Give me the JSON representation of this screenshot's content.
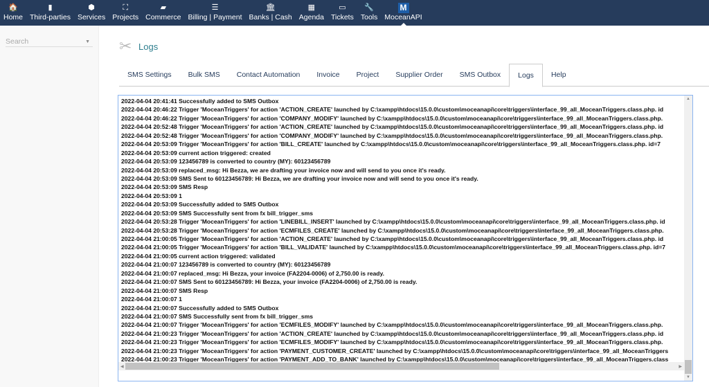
{
  "topnav": [
    {
      "label": "Home",
      "icon": "🏠"
    },
    {
      "label": "Third-parties",
      "icon": "▮"
    },
    {
      "label": "Services",
      "icon": "⬢"
    },
    {
      "label": "Projects",
      "icon": "⛶"
    },
    {
      "label": "Commerce",
      "icon": "▰"
    },
    {
      "label": "Billing | Payment",
      "icon": "☰"
    },
    {
      "label": "Banks | Cash",
      "icon": "🏛"
    },
    {
      "label": "Agenda",
      "icon": "▦"
    },
    {
      "label": "Tickets",
      "icon": "▭"
    },
    {
      "label": "Tools",
      "icon": "🔧"
    },
    {
      "label": "MoceanAPI",
      "icon": "M"
    }
  ],
  "sidebar": {
    "search_placeholder": "Search"
  },
  "page": {
    "title": "Logs"
  },
  "tabs": [
    "SMS Settings",
    "Bulk SMS",
    "Contact Automation",
    "Invoice",
    "Project",
    "Supplier Order",
    "SMS Outbox",
    "Logs",
    "Help"
  ],
  "logs": [
    "2022-04-04 20:41:41 Successfully added to SMS Outbox",
    "2022-04-04 20:46:22 Trigger 'MoceanTriggers' for action 'ACTION_CREATE' launched by C:\\xampp\\htdocs\\15.0.0\\custom\\moceanapi\\core\\triggers\\interface_99_all_MoceanTriggers.class.php. id",
    "2022-04-04 20:46:22 Trigger 'MoceanTriggers' for action 'COMPANY_MODIFY' launched by C:\\xampp\\htdocs\\15.0.0\\custom\\moceanapi\\core\\triggers\\interface_99_all_MoceanTriggers.class.php.",
    "2022-04-04 20:52:48 Trigger 'MoceanTriggers' for action 'ACTION_CREATE' launched by C:\\xampp\\htdocs\\15.0.0\\custom\\moceanapi\\core\\triggers\\interface_99_all_MoceanTriggers.class.php. id",
    "2022-04-04 20:52:48 Trigger 'MoceanTriggers' for action 'COMPANY_MODIFY' launched by C:\\xampp\\htdocs\\15.0.0\\custom\\moceanapi\\core\\triggers\\interface_99_all_MoceanTriggers.class.php.",
    "2022-04-04 20:53:09 Trigger 'MoceanTriggers' for action 'BILL_CREATE' launched by C:\\xampp\\htdocs\\15.0.0\\custom\\moceanapi\\core\\triggers\\interface_99_all_MoceanTriggers.class.php. id=7",
    "2022-04-04 20:53:09 current action triggered: created",
    "2022-04-04 20:53:09 123456789 is converted to country (MY): 60123456789",
    "2022-04-04 20:53:09 replaced_msg: Hi Bezza, we are drafting your invoice now and will send to you once it's ready.",
    "2022-04-04 20:53:09 SMS Sent to 60123456789: Hi Bezza, we are drafting your invoice now and will send to you once it's ready.",
    "2022-04-04 20:53:09 SMS Resp",
    "2022-04-04 20:53:09 1",
    "2022-04-04 20:53:09 Successfully added to SMS Outbox",
    "2022-04-04 20:53:09 SMS Successfully sent from fx bill_trigger_sms",
    "2022-04-04 20:53:28 Trigger 'MoceanTriggers' for action 'LINEBILL_INSERT' launched by C:\\xampp\\htdocs\\15.0.0\\custom\\moceanapi\\core\\triggers\\interface_99_all_MoceanTriggers.class.php. id",
    "2022-04-04 20:53:28 Trigger 'MoceanTriggers' for action 'ECMFILES_CREATE' launched by C:\\xampp\\htdocs\\15.0.0\\custom\\moceanapi\\core\\triggers\\interface_99_all_MoceanTriggers.class.php.",
    "2022-04-04 21:00:05 Trigger 'MoceanTriggers' for action 'ACTION_CREATE' launched by C:\\xampp\\htdocs\\15.0.0\\custom\\moceanapi\\core\\triggers\\interface_99_all_MoceanTriggers.class.php. id",
    "2022-04-04 21:00:05 Trigger 'MoceanTriggers' for action 'BILL_VALIDATE' launched by C:\\xampp\\htdocs\\15.0.0\\custom\\moceanapi\\core\\triggers\\interface_99_all_MoceanTriggers.class.php. id=7",
    "2022-04-04 21:00:05 current action triggered: validated",
    "2022-04-04 21:00:07 123456789 is converted to country (MY): 60123456789",
    "2022-04-04 21:00:07 replaced_msg: Hi Bezza, your invoice (FA2204-0006) of 2,750.00 is ready.",
    "2022-04-04 21:00:07 SMS Sent to 60123456789: Hi Bezza, your invoice (FA2204-0006) of 2,750.00 is ready.",
    "2022-04-04 21:00:07 SMS Resp",
    "2022-04-04 21:00:07 1",
    "2022-04-04 21:00:07 Successfully added to SMS Outbox",
    "2022-04-04 21:00:07 SMS Successfully sent from fx bill_trigger_sms",
    "2022-04-04 21:00:07 Trigger 'MoceanTriggers' for action 'ECMFILES_MODIFY' launched by C:\\xampp\\htdocs\\15.0.0\\custom\\moceanapi\\core\\triggers\\interface_99_all_MoceanTriggers.class.php.",
    "2022-04-04 21:00:23 Trigger 'MoceanTriggers' for action 'ACTION_CREATE' launched by C:\\xampp\\htdocs\\15.0.0\\custom\\moceanapi\\core\\triggers\\interface_99_all_MoceanTriggers.class.php. id",
    "2022-04-04 21:00:23 Trigger 'MoceanTriggers' for action 'ECMFILES_MODIFY' launched by C:\\xampp\\htdocs\\15.0.0\\custom\\moceanapi\\core\\triggers\\interface_99_all_MoceanTriggers.class.php.",
    "2022-04-04 21:00:23 Trigger 'MoceanTriggers' for action 'PAYMENT_CUSTOMER_CREATE' launched by C:\\xampp\\htdocs\\15.0.0\\custom\\moceanapi\\core\\triggers\\interface_99_all_MoceanTriggers",
    "2022-04-04 21:00:23 Trigger 'MoceanTriggers' for action 'PAYMENT_ADD_TO_BANK' launched by C:\\xampp\\htdocs\\15.0.0\\custom\\moceanapi\\core\\triggers\\interface_99_all_MoceanTriggers.class"
  ]
}
